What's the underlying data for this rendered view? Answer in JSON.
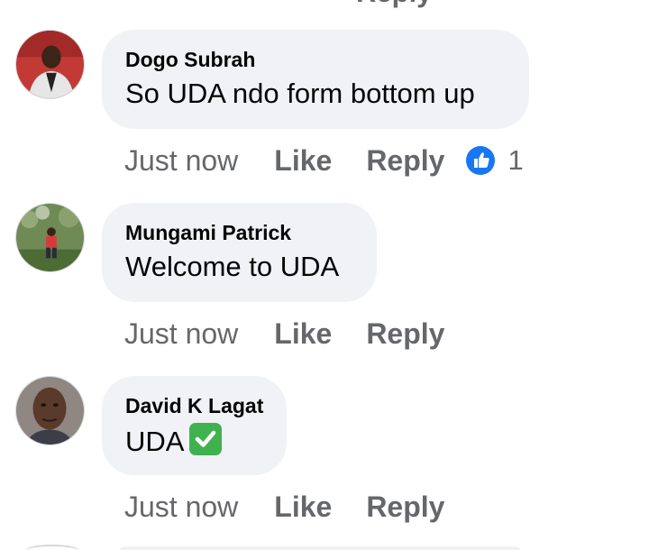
{
  "clipped_above": {
    "label": "Reply"
  },
  "comments": [
    {
      "author": "Dogo Subrah",
      "text": "So UDA ndo form bottom up",
      "time": "Just now",
      "like_label": "Like",
      "reply_label": "Reply",
      "reaction_count": "1",
      "reaction_icon": "like-icon",
      "avatar_icon": "avatar-photo"
    },
    {
      "author": "Mungami Patrick",
      "text": "Welcome to UDA",
      "time": "Just now",
      "like_label": "Like",
      "reply_label": "Reply",
      "avatar_icon": "avatar-photo"
    },
    {
      "author": "David K Lagat",
      "text": "UDA",
      "emoji": "check-mark-icon",
      "time": "Just now",
      "like_label": "Like",
      "reply_label": "Reply",
      "avatar_icon": "avatar-photo"
    }
  ],
  "colors": {
    "bubble": "#f0f2f5",
    "meta_text": "#65676b",
    "like_blue": "#1877f2",
    "check_green": "#3fb24f"
  }
}
